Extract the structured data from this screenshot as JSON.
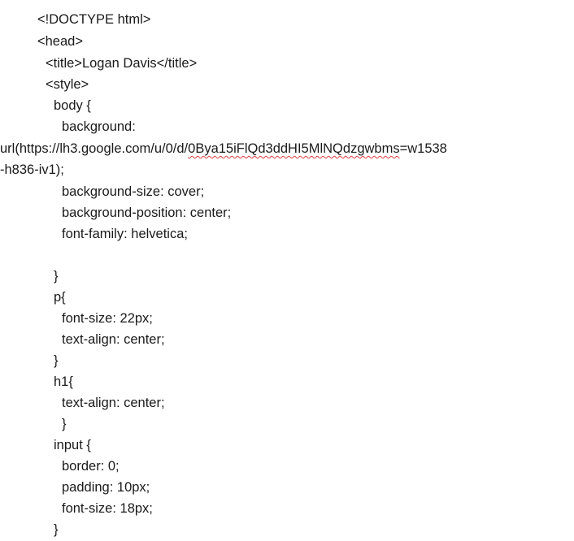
{
  "document": {
    "lines": [
      "<!DOCTYPE html>",
      "<head>",
      "<title>Logan Davis</title>",
      "<style>",
      "body {",
      "background:",
      "url(https://lh3.google.com/u/0/d/",
      "0Bya15iFlQd3ddHI5MlNQdzgwbms",
      "=w1538",
      "-h836-iv1);",
      "background-size: cover;",
      "background-position: center;",
      "font-family: helvetica;",
      "}",
      "p{",
      "font-size: 22px;",
      "text-align: center;",
      "}",
      "h1{",
      "text-align: center;",
      "}",
      "input {",
      "border: 0;",
      "padding: 10px;",
      "font-size: 18px;",
      "}"
    ]
  }
}
